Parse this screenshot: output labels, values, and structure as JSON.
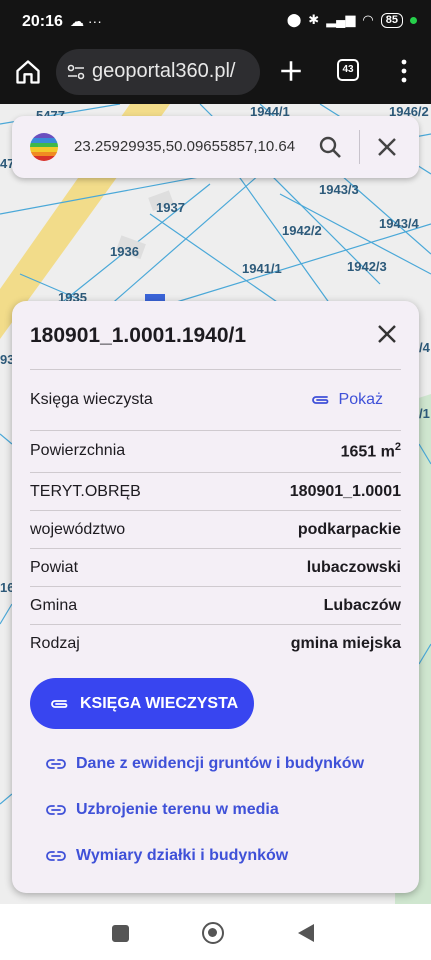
{
  "status_bar": {
    "time": "20:16",
    "battery": "85"
  },
  "browser": {
    "url": "geoportal360.pl/",
    "tab_count": "43"
  },
  "map": {
    "labels": [
      "5477",
      "1944/1",
      "1946/2",
      "47",
      "1937",
      "1943/3",
      "1942/2",
      "1943/4",
      "1936",
      "1941/1",
      "1942/3",
      "1935",
      "93",
      "/4",
      "/1",
      "16"
    ]
  },
  "search": {
    "coordinates": "23.25929935,50.09655857,10.64"
  },
  "card": {
    "title": "180901_1.0001.1940/1",
    "rows": [
      {
        "label": "Księga wieczysta",
        "value": "Pokaż"
      },
      {
        "label": "Powierzchnia",
        "value": "1651 m",
        "sup": "2"
      },
      {
        "label": "TERYT.OBRĘB",
        "value": "180901_1.0001"
      },
      {
        "label": "województwo",
        "value": "podkarpackie"
      },
      {
        "label": "Powiat",
        "value": "lubaczowski"
      },
      {
        "label": "Gmina",
        "value": "Lubaczów"
      },
      {
        "label": "Rodzaj",
        "value": "gmina miejska"
      }
    ],
    "button": "KSIĘGA WIECZYSTA",
    "links": [
      "Dane z ewidencji gruntów i budynków",
      "Uzbrojenie terenu w media",
      "Wymiary działki i budynków"
    ]
  },
  "colors": {
    "accent": "#3845f0",
    "link": "#3f51d8",
    "parcel_line": "#4aa8d8",
    "road": "#f2dc8a"
  }
}
